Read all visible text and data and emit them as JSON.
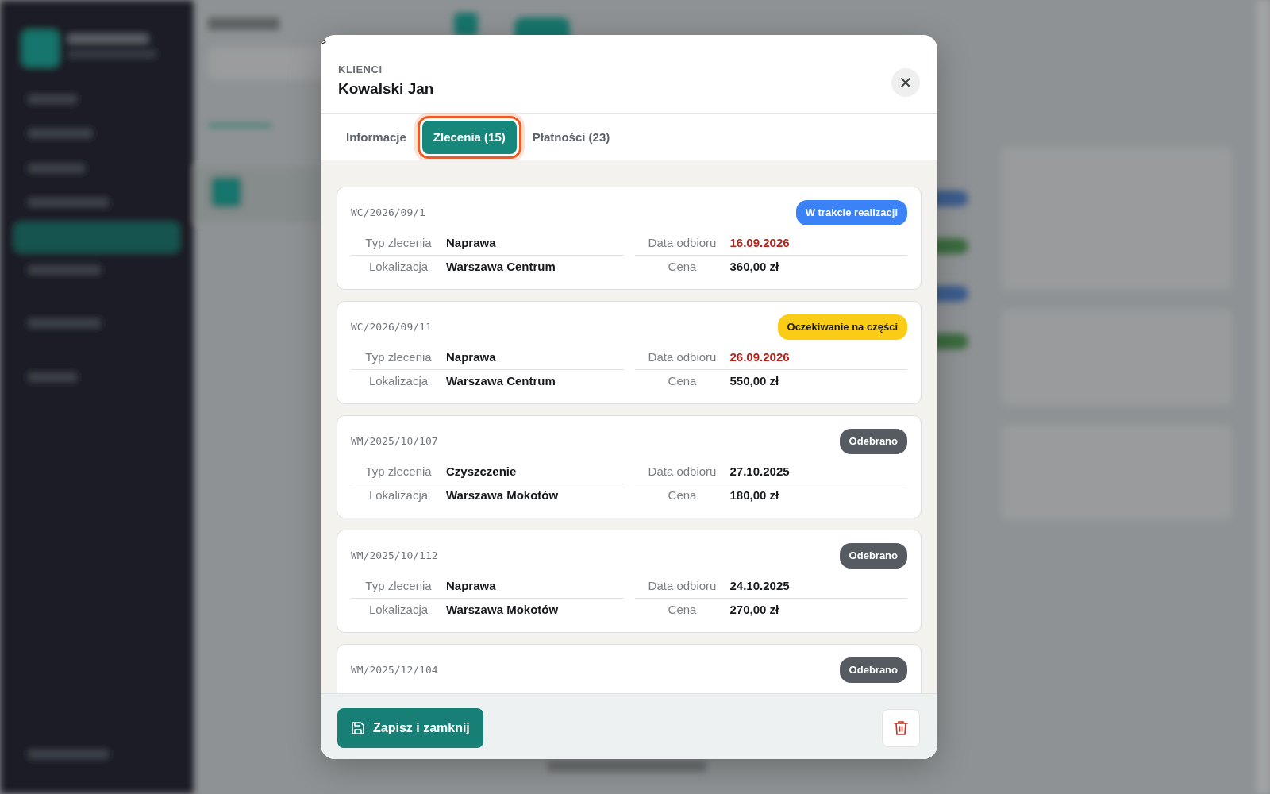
{
  "corner_mark": ">",
  "modal": {
    "eyebrow": "KLIENCI",
    "title": "Kowalski Jan",
    "tabs": [
      {
        "label": "Informacje",
        "selected": false
      },
      {
        "label": "Zlecenia (15)",
        "selected": true
      },
      {
        "label": "Płatności (23)",
        "selected": false
      }
    ],
    "orders": [
      {
        "number": "WC/2026/09/1",
        "badge": {
          "label": "W trakcie realizacji",
          "kind": "in_progress"
        },
        "fields": [
          {
            "label": "Typ zlecenia",
            "value": "Naprawa",
            "highlighted": false
          },
          {
            "label": "Data odbioru",
            "value": "16.09.2026",
            "highlighted": true
          },
          {
            "label": "Lokalizacja",
            "value": "Warszawa Centrum",
            "highlighted": false
          },
          {
            "label": "Cena",
            "value": "360,00 zł",
            "highlighted": false
          }
        ]
      },
      {
        "number": "WC/2026/09/11",
        "badge": {
          "label": "Oczekiwanie na części",
          "kind": "waiting"
        },
        "fields": [
          {
            "label": "Typ zlecenia",
            "value": "Naprawa",
            "highlighted": false
          },
          {
            "label": "Data odbioru",
            "value": "26.09.2026",
            "highlighted": true
          },
          {
            "label": "Lokalizacja",
            "value": "Warszawa Centrum",
            "highlighted": false
          },
          {
            "label": "Cena",
            "value": "550,00 zł",
            "highlighted": false
          }
        ]
      },
      {
        "number": "WM/2025/10/107",
        "badge": {
          "label": "Odebrano",
          "kind": "done"
        },
        "fields": [
          {
            "label": "Typ zlecenia",
            "value": "Czyszczenie",
            "highlighted": false
          },
          {
            "label": "Data odbioru",
            "value": "27.10.2025",
            "highlighted": false
          },
          {
            "label": "Lokalizacja",
            "value": "Warszawa Mokotów",
            "highlighted": false
          },
          {
            "label": "Cena",
            "value": "180,00 zł",
            "highlighted": false
          }
        ]
      },
      {
        "number": "WM/2025/10/112",
        "badge": {
          "label": "Odebrano",
          "kind": "done"
        },
        "fields": [
          {
            "label": "Typ zlecenia",
            "value": "Naprawa",
            "highlighted": false
          },
          {
            "label": "Data odbioru",
            "value": "24.10.2025",
            "highlighted": false
          },
          {
            "label": "Lokalizacja",
            "value": "Warszawa Mokotów",
            "highlighted": false
          },
          {
            "label": "Cena",
            "value": "270,00 zł",
            "highlighted": false
          }
        ]
      },
      {
        "number": "WM/2025/12/104",
        "badge": {
          "label": "Odebrano",
          "kind": "done"
        }
      }
    ],
    "save_button": "Zapisz i zamknij"
  }
}
